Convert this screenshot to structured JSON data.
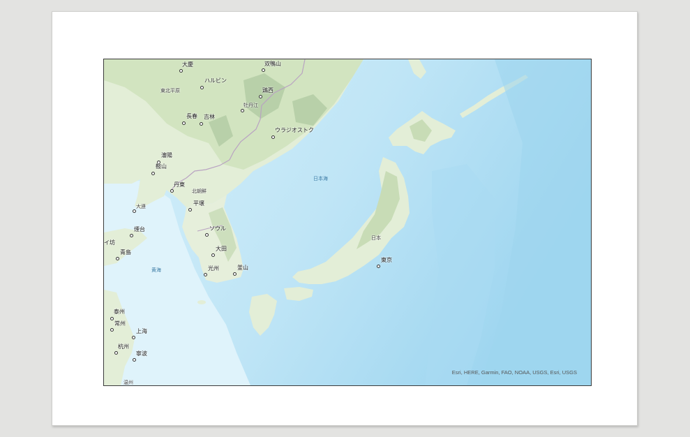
{
  "map": {
    "attribution": "Esri, HERE, Garmin, FAO, NOAA, USGS, Esri, USGS",
    "colors": {
      "ocean_deep": "#a9dbf2",
      "ocean_shallow": "#d3eef9",
      "land": "#eaf1e2",
      "forest": "#cfe2be",
      "mountain": "#b4cca4",
      "border": "#b9a3c2",
      "frame": "#3a3a3a"
    },
    "labels": {
      "daqing": "大慶",
      "shuangyashan": "双鴨山",
      "harbin": "ハルビン",
      "dongbei_plain": "東北平原",
      "jixi": "鶏西",
      "mudanjiang": "牡丹江",
      "changchun": "長春",
      "jilin": "吉林",
      "vladivostok": "ウラジオストク",
      "shenyang": "瀋陽",
      "anshan": "鞍山",
      "sea_of_japan": "日本海",
      "dandong": "丹東",
      "north_korea": "北朝鮮",
      "dalian": "大連",
      "pyongyang": "平壌",
      "yantai": "煙台",
      "seoul": "ソウル",
      "weifang": "イ坊",
      "qingdao": "青島",
      "daejeon": "大田",
      "japan": "日本",
      "tokyo": "東京",
      "yellow_sea": "黄海",
      "gwangju": "光州",
      "busan": "釜山",
      "taizhou": "泰州",
      "changzhou": "常州",
      "shanghai": "上海",
      "hangzhou": "杭州",
      "ningbo": "寧波",
      "wenzhou": "温州"
    }
  }
}
